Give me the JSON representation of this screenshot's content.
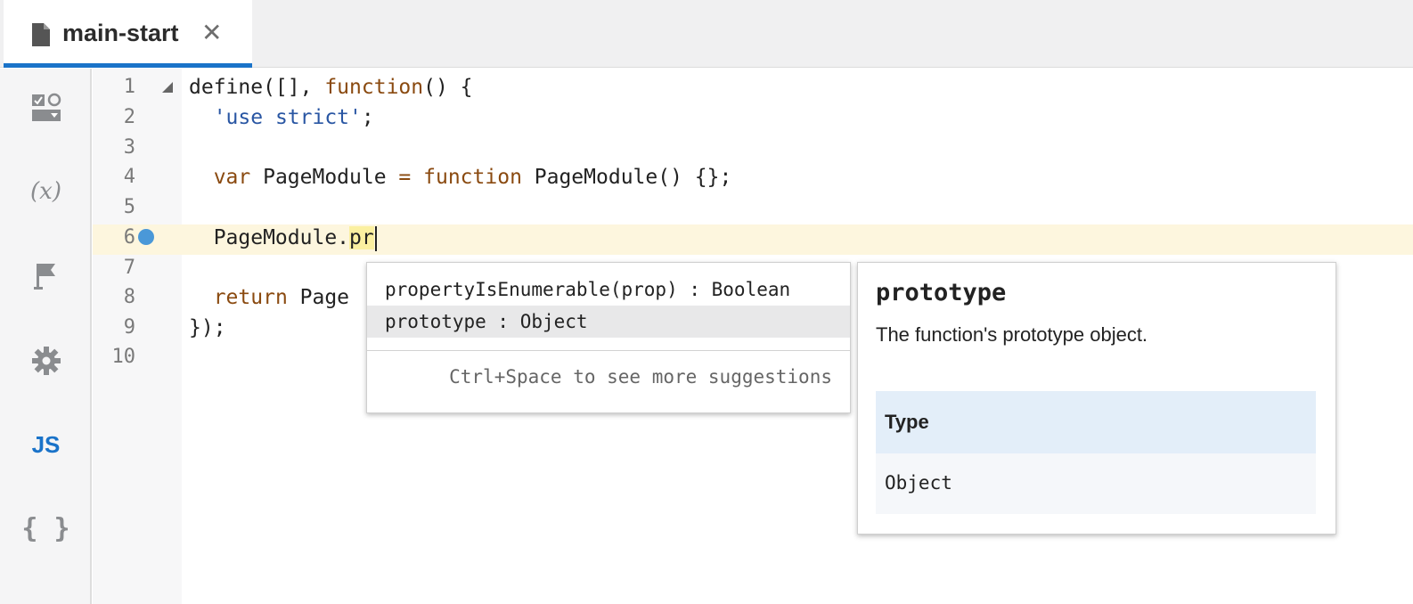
{
  "tab": {
    "title": "main-start",
    "close_glyph": "✕"
  },
  "sidebar": [
    {
      "name": "page-structure-icon"
    },
    {
      "name": "variables-icon",
      "glyph": "(𝑥)"
    },
    {
      "name": "flag-icon"
    },
    {
      "name": "settings-gear-icon"
    },
    {
      "name": "javascript-icon",
      "glyph": "JS"
    },
    {
      "name": "json-braces-icon",
      "glyph": "{ }"
    }
  ],
  "editor": {
    "line_numbers": [
      "1",
      "2",
      "3",
      "4",
      "5",
      "6",
      "7",
      "8",
      "9",
      "10"
    ],
    "active_line": 6
  },
  "autocomplete": {
    "items": [
      {
        "label": "propertyIsEnumerable(prop) : Boolean"
      },
      {
        "label": "prototype : Object",
        "selected": true
      }
    ],
    "hint": "Ctrl+Space to see more suggestions"
  },
  "doc_popup": {
    "title": "prototype",
    "description": "The function's prototype object.",
    "type_header": "Type",
    "type_value": "Object"
  },
  "colors": {
    "accent": "#1a73c9",
    "keyword": "#8a4a10",
    "string": "#2956a3",
    "active_line_bg": "#fdf6de"
  }
}
